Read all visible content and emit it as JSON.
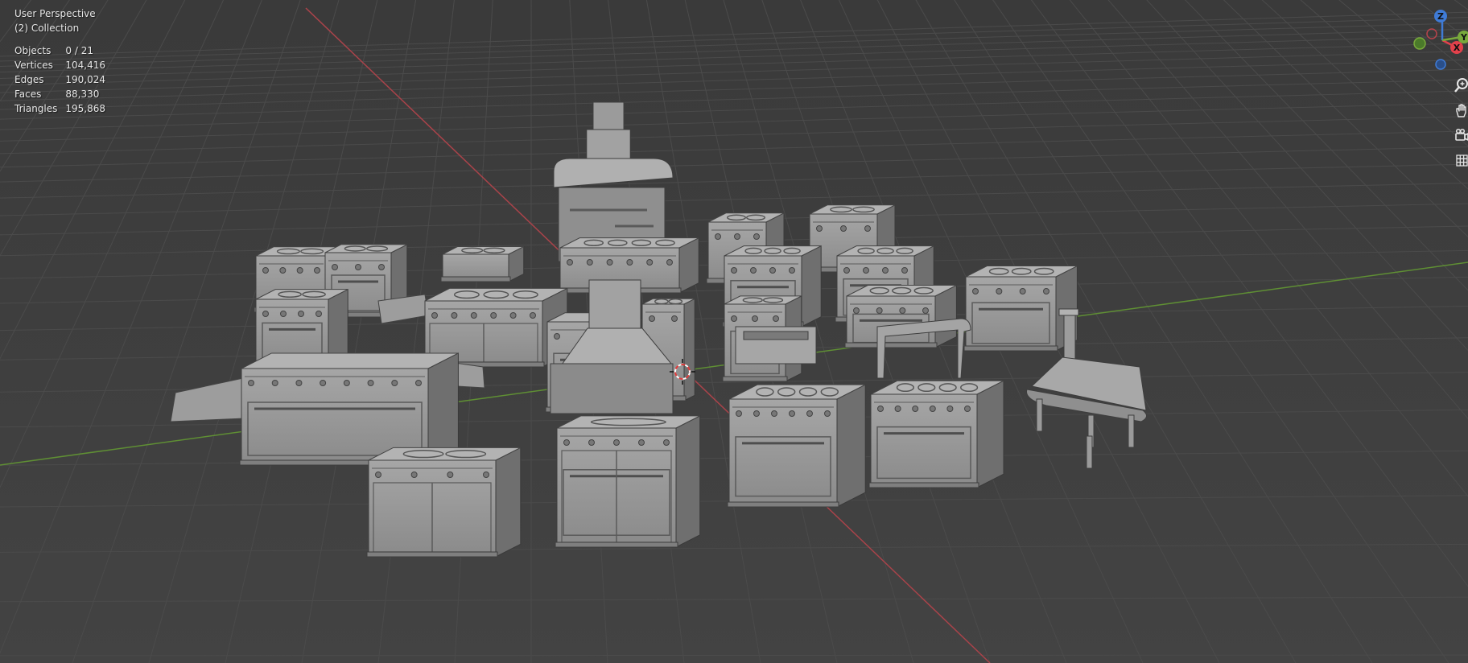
{
  "viewport": {
    "view_name": "User Perspective",
    "collection": "(2) Collection"
  },
  "stats": [
    {
      "label": "Objects",
      "value": "0 / 21"
    },
    {
      "label": "Vertices",
      "value": "104,416"
    },
    {
      "label": "Edges",
      "value": "190,024"
    },
    {
      "label": "Faces",
      "value": "88,330"
    },
    {
      "label": "Triangles",
      "value": "195,868"
    }
  ],
  "gizmo": {
    "z_label": "Z",
    "x_label": "X",
    "y_label": "Y",
    "colors": {
      "x": "#e2414b",
      "y": "#79a93c",
      "z": "#3f7bd6"
    }
  },
  "nav_tools": [
    {
      "icon": "zoom-icon"
    },
    {
      "icon": "hand-pan-icon"
    },
    {
      "icon": "camera-icon"
    },
    {
      "icon": "grid-ortho-icon"
    }
  ],
  "colors": {
    "background": "#3e3e3e",
    "grid": "#4a4a4a",
    "x_axis": "#b8464c",
    "y_axis": "#6a9a3a",
    "mesh": "#9a9a9a"
  }
}
